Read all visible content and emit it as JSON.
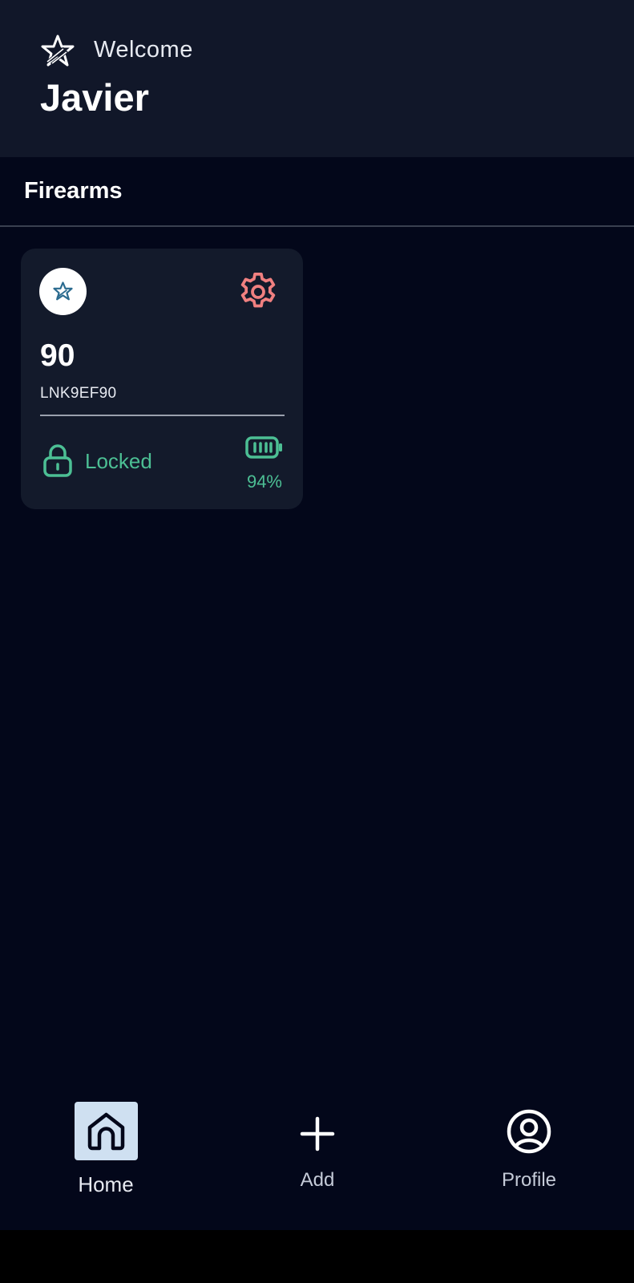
{
  "header": {
    "greeting": "Welcome",
    "username": "Javier",
    "logo_icon": "star-logo-icon"
  },
  "section": {
    "title": "Firearms"
  },
  "cards": [
    {
      "number": "90",
      "serial": "LNK9EF90",
      "status": "Locked",
      "battery": "94%",
      "battery_level": 0.94,
      "avatar_icon": "star-logo-icon",
      "settings_icon": "gear-icon",
      "status_icon": "lock-icon",
      "battery_icon": "battery-icon"
    }
  ],
  "nav": {
    "items": [
      {
        "label": "Home",
        "icon": "home-icon",
        "active": true
      },
      {
        "label": "Add",
        "icon": "plus-icon",
        "active": false
      },
      {
        "label": "Profile",
        "icon": "profile-icon",
        "active": false
      }
    ]
  },
  "colors": {
    "background": "#03071a",
    "header": "#111729",
    "card": "#131a2b",
    "success": "#4cbf94",
    "settings": "#f08080",
    "nav_active": "#cfe0f1"
  }
}
